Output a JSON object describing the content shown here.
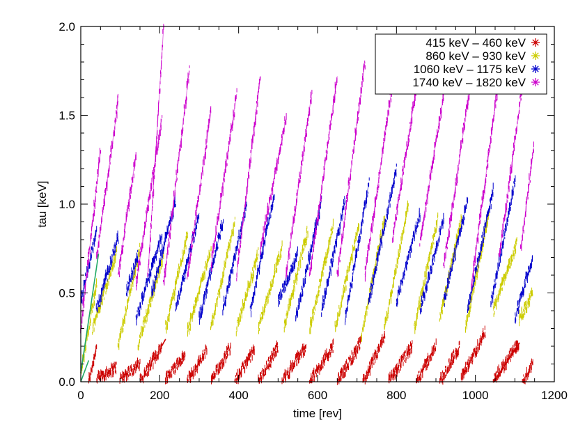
{
  "chart_data": {
    "type": "scatter",
    "title": "",
    "xlabel": "time [rev]",
    "ylabel": "tau [keV]",
    "xlim": [
      0,
      1200
    ],
    "ylim": [
      0,
      2.0
    ],
    "xticks": [
      "0",
      "200",
      "400",
      "600",
      "800",
      "1000",
      "1200"
    ],
    "yticks": [
      "0.0",
      "0.5",
      "1.0",
      "1.5",
      "2.0"
    ],
    "xtick_values": [
      0,
      200,
      400,
      600,
      800,
      1000,
      1200
    ],
    "ytick_values": [
      0,
      0.5,
      1.0,
      1.5,
      2.0
    ],
    "legend_position": "top-right",
    "grid": false,
    "series": [
      {
        "name": "415 keV – 460 keV",
        "color": "#cc0000",
        "cycles": [
          {
            "x0": 20,
            "x1": 40,
            "y0": 0.0,
            "y1": 0.2
          },
          {
            "x0": 40,
            "x1": 90,
            "y0": 0.02,
            "y1": 0.08
          },
          {
            "x0": 100,
            "x1": 150,
            "y0": 0.02,
            "y1": 0.1
          },
          {
            "x0": 150,
            "x1": 205,
            "y0": 0.0,
            "y1": 0.2
          },
          {
            "x0": 215,
            "x1": 265,
            "y0": 0.02,
            "y1": 0.15
          },
          {
            "x0": 270,
            "x1": 320,
            "y0": 0.0,
            "y1": 0.18
          },
          {
            "x0": 330,
            "x1": 380,
            "y0": 0.0,
            "y1": 0.2
          },
          {
            "x0": 390,
            "x1": 440,
            "y0": 0.0,
            "y1": 0.18
          },
          {
            "x0": 450,
            "x1": 500,
            "y0": 0.0,
            "y1": 0.2
          },
          {
            "x0": 510,
            "x1": 570,
            "y0": 0.0,
            "y1": 0.2
          },
          {
            "x0": 580,
            "x1": 640,
            "y0": 0.0,
            "y1": 0.2
          },
          {
            "x0": 650,
            "x1": 710,
            "y0": 0.0,
            "y1": 0.22
          },
          {
            "x0": 715,
            "x1": 770,
            "y0": 0.0,
            "y1": 0.25
          },
          {
            "x0": 780,
            "x1": 840,
            "y0": 0.0,
            "y1": 0.2
          },
          {
            "x0": 850,
            "x1": 900,
            "y0": 0.0,
            "y1": 0.2
          },
          {
            "x0": 910,
            "x1": 960,
            "y0": 0.0,
            "y1": 0.2
          },
          {
            "x0": 965,
            "x1": 1025,
            "y0": 0.02,
            "y1": 0.28
          },
          {
            "x0": 1045,
            "x1": 1110,
            "y0": 0.0,
            "y1": 0.22
          },
          {
            "x0": 1120,
            "x1": 1145,
            "y0": 0.0,
            "y1": 0.1
          }
        ]
      },
      {
        "name": "860 keV – 930 keV",
        "color": "#cccc00",
        "cycles": [
          {
            "x0": 0,
            "x1": 40,
            "y0": 0.05,
            "y1": 0.55
          },
          {
            "x0": 30,
            "x1": 90,
            "y0": 0.3,
            "y1": 0.72
          },
          {
            "x0": 95,
            "x1": 150,
            "y0": 0.2,
            "y1": 0.75
          },
          {
            "x0": 145,
            "x1": 210,
            "y0": 0.2,
            "y1": 0.72
          },
          {
            "x0": 215,
            "x1": 270,
            "y0": 0.3,
            "y1": 0.82
          },
          {
            "x0": 270,
            "x1": 330,
            "y0": 0.28,
            "y1": 0.75
          },
          {
            "x0": 330,
            "x1": 390,
            "y0": 0.3,
            "y1": 0.9
          },
          {
            "x0": 395,
            "x1": 450,
            "y0": 0.3,
            "y1": 0.72
          },
          {
            "x0": 450,
            "x1": 510,
            "y0": 0.3,
            "y1": 0.75
          },
          {
            "x0": 515,
            "x1": 575,
            "y0": 0.3,
            "y1": 0.85
          },
          {
            "x0": 580,
            "x1": 640,
            "y0": 0.3,
            "y1": 0.88
          },
          {
            "x0": 645,
            "x1": 705,
            "y0": 0.3,
            "y1": 0.88
          },
          {
            "x0": 710,
            "x1": 770,
            "y0": 0.25,
            "y1": 0.92
          },
          {
            "x0": 770,
            "x1": 830,
            "y0": 0.3,
            "y1": 1.0
          },
          {
            "x0": 845,
            "x1": 905,
            "y0": 0.3,
            "y1": 0.92
          },
          {
            "x0": 910,
            "x1": 965,
            "y0": 0.35,
            "y1": 0.92
          },
          {
            "x0": 975,
            "x1": 1035,
            "y0": 0.3,
            "y1": 0.95
          },
          {
            "x0": 1045,
            "x1": 1105,
            "y0": 0.4,
            "y1": 0.78
          },
          {
            "x0": 1110,
            "x1": 1145,
            "y0": 0.35,
            "y1": 0.5
          }
        ]
      },
      {
        "name": "1060 keV – 1175 keV",
        "color": "#0000cc",
        "cycles": [
          {
            "x0": 0,
            "x1": 40,
            "y0": 0.45,
            "y1": 0.85
          },
          {
            "x0": 40,
            "x1": 95,
            "y0": 0.4,
            "y1": 0.82
          },
          {
            "x0": 115,
            "x1": 145,
            "y0": 0.5,
            "y1": 0.72
          },
          {
            "x0": 140,
            "x1": 205,
            "y0": 0.35,
            "y1": 0.82
          },
          {
            "x0": 180,
            "x1": 240,
            "y0": 0.5,
            "y1": 1.02
          },
          {
            "x0": 240,
            "x1": 300,
            "y0": 0.4,
            "y1": 0.95
          },
          {
            "x0": 300,
            "x1": 360,
            "y0": 0.35,
            "y1": 0.9
          },
          {
            "x0": 360,
            "x1": 420,
            "y0": 0.4,
            "y1": 1.0
          },
          {
            "x0": 430,
            "x1": 490,
            "y0": 0.4,
            "y1": 1.05
          },
          {
            "x0": 500,
            "x1": 550,
            "y0": 0.45,
            "y1": 0.72
          },
          {
            "x0": 545,
            "x1": 610,
            "y0": 0.35,
            "y1": 1.02
          },
          {
            "x0": 610,
            "x1": 670,
            "y0": 0.4,
            "y1": 1.02
          },
          {
            "x0": 670,
            "x1": 730,
            "y0": 0.35,
            "y1": 1.12
          },
          {
            "x0": 730,
            "x1": 800,
            "y0": 0.45,
            "y1": 1.2
          },
          {
            "x0": 800,
            "x1": 860,
            "y0": 0.45,
            "y1": 0.95
          },
          {
            "x0": 860,
            "x1": 920,
            "y0": 0.4,
            "y1": 0.92
          },
          {
            "x0": 920,
            "x1": 980,
            "y0": 0.45,
            "y1": 1.02
          },
          {
            "x0": 980,
            "x1": 1045,
            "y0": 0.4,
            "y1": 1.08
          },
          {
            "x0": 1040,
            "x1": 1100,
            "y0": 0.45,
            "y1": 1.12
          },
          {
            "x0": 1100,
            "x1": 1145,
            "y0": 0.35,
            "y1": 0.7
          }
        ]
      },
      {
        "name": "1740 keV – 1820 keV",
        "color": "#cc00cc",
        "cycles": [
          {
            "x0": 0,
            "x1": 50,
            "y0": 0.3,
            "y1": 1.3
          },
          {
            "x0": 40,
            "x1": 95,
            "y0": 0.7,
            "y1": 1.58
          },
          {
            "x0": 95,
            "x1": 140,
            "y0": 0.6,
            "y1": 1.28
          },
          {
            "x0": 140,
            "x1": 205,
            "y0": 0.55,
            "y1": 1.48
          },
          {
            "x0": 170,
            "x1": 210,
            "y0": 0.6,
            "y1": 2.0
          },
          {
            "x0": 210,
            "x1": 275,
            "y0": 0.55,
            "y1": 1.75
          },
          {
            "x0": 270,
            "x1": 330,
            "y0": 0.6,
            "y1": 1.52
          },
          {
            "x0": 330,
            "x1": 395,
            "y0": 0.65,
            "y1": 1.62
          },
          {
            "x0": 395,
            "x1": 455,
            "y0": 0.6,
            "y1": 1.72
          },
          {
            "x0": 455,
            "x1": 520,
            "y0": 0.75,
            "y1": 1.48
          },
          {
            "x0": 520,
            "x1": 585,
            "y0": 0.6,
            "y1": 1.62
          },
          {
            "x0": 580,
            "x1": 650,
            "y0": 0.6,
            "y1": 1.72
          },
          {
            "x0": 650,
            "x1": 720,
            "y0": 0.6,
            "y1": 1.8
          },
          {
            "x0": 720,
            "x1": 790,
            "y0": 0.6,
            "y1": 1.68
          },
          {
            "x0": 790,
            "x1": 860,
            "y0": 0.8,
            "y1": 1.8
          },
          {
            "x0": 860,
            "x1": 920,
            "y0": 0.8,
            "y1": 1.62
          },
          {
            "x0": 920,
            "x1": 990,
            "y0": 0.65,
            "y1": 1.72
          },
          {
            "x0": 990,
            "x1": 1060,
            "y0": 0.55,
            "y1": 1.72
          },
          {
            "x0": 1060,
            "x1": 1120,
            "y0": 0.7,
            "y1": 1.68
          },
          {
            "x0": 1115,
            "x1": 1148,
            "y0": 0.75,
            "y1": 1.32
          }
        ]
      }
    ],
    "fit_lines": [
      {
        "color": "#cc0000",
        "x0": 1048,
        "y0": 0.0,
        "x1": 1112,
        "y1": 0.22
      },
      {
        "color": "#cc0000",
        "x0": 205,
        "y0": 0.2,
        "x1": 215,
        "y1": 0.24
      },
      {
        "color": "#22aa66",
        "x0": 0,
        "y0": 0.0,
        "x1": 20,
        "y1": 0.12
      },
      {
        "color": "#22aa66",
        "x0": 0,
        "y0": 0.05,
        "x1": 45,
        "y1": 0.72
      }
    ]
  }
}
